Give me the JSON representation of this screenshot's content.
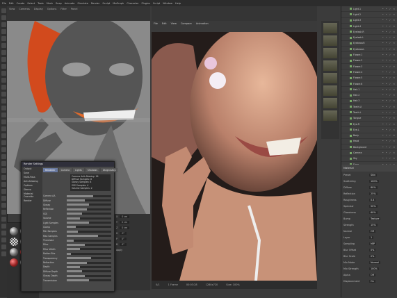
{
  "menu": [
    "File",
    "Edit",
    "Create",
    "Select",
    "Tools",
    "Mesh",
    "Snap",
    "Animate",
    "Simulate",
    "Render",
    "Sculpt",
    "MoGraph",
    "Character",
    "Plugins",
    "Script",
    "Window",
    "Help"
  ],
  "viewport_toolbar": [
    "View",
    "Cameras",
    "Display",
    "Options",
    "Filter",
    "Panel"
  ],
  "render_window": {
    "menu": [
      "File",
      "Edit",
      "View",
      "Compare",
      "Animation"
    ],
    "status": [
      "0/1",
      "1 Frame",
      "00:03:28",
      "1280x720",
      "Size: 100%"
    ]
  },
  "object_manager": {
    "rows": [
      {
        "label": "Light.1"
      },
      {
        "label": "Light.2"
      },
      {
        "label": "Light.3"
      },
      {
        "label": "Light.4"
      },
      {
        "label": "Eyelash.R"
      },
      {
        "label": "Eyelash.L"
      },
      {
        "label": "Eyebrow.R"
      },
      {
        "label": "Eyebrow.L"
      },
      {
        "label": "Flower.1"
      },
      {
        "label": "Flower.2"
      },
      {
        "label": "Flower.3"
      },
      {
        "label": "Flower.4"
      },
      {
        "label": "Flower.5"
      },
      {
        "label": "Flower.6"
      },
      {
        "label": "Hair.1"
      },
      {
        "label": "Hair.2"
      },
      {
        "label": "Hair.3"
      },
      {
        "label": "Teeth.U"
      },
      {
        "label": "Teeth.L"
      },
      {
        "label": "Tongue"
      },
      {
        "label": "Eye.R"
      },
      {
        "label": "Eye.L"
      },
      {
        "label": "Body"
      },
      {
        "label": "Head"
      },
      {
        "label": "Background"
      },
      {
        "label": "Camera"
      },
      {
        "label": "Sky"
      },
      {
        "label": "Floor"
      },
      {
        "label": "Null"
      }
    ]
  },
  "attributes": {
    "header": "Material",
    "tabs": [
      "Basic",
      "Shader",
      "Channels",
      "Advanced"
    ],
    "rows": [
      {
        "label": "Preset",
        "value": "Skin"
      },
      {
        "label": "Scattering",
        "value": "100%"
      },
      {
        "label": "Diffuse",
        "value": "80%"
      },
      {
        "label": "Reflection",
        "value": "25%"
      },
      {
        "label": "Roughness",
        "value": "0.4"
      },
      {
        "label": "Specular",
        "value": "50%"
      },
      {
        "label": "Glossiness",
        "value": "60%"
      },
      {
        "label": "Bump",
        "value": "Texture"
      },
      {
        "label": "Strength",
        "value": "15%"
      },
      {
        "label": "Normal",
        "value": "Off"
      },
      {
        "label": "Layer",
        "value": "1"
      },
      {
        "label": "Sampling",
        "value": "MIP"
      },
      {
        "label": "Blur Offset",
        "value": "0%"
      },
      {
        "label": "Blur Scale",
        "value": "0%"
      },
      {
        "label": "Mix Mode",
        "value": "Normal"
      },
      {
        "label": "Mix Strength",
        "value": "100%"
      },
      {
        "label": "Alpha",
        "value": "Off"
      },
      {
        "label": "Displacement",
        "value": "On"
      }
    ]
  },
  "dialog": {
    "title": "Render Settings",
    "left_items": [
      "Output",
      "Save",
      "Multi-Pass",
      "Anti-Aliasing",
      "Options",
      "Stereo",
      "Material Override",
      "Render"
    ],
    "tabs": [
      "Renderer",
      "Camera",
      "Lights",
      "Shadows",
      "Diagnostics"
    ],
    "info": [
      "Camera Anti-Aliasing: 16",
      "Diffuse Samples: 8",
      "Glossy Samples: 8",
      "SSS Samples: 4",
      "Volume Samples: 2"
    ],
    "rows": [
      {
        "label": "Camera AA",
        "fill": 0.6
      },
      {
        "label": "Diffuse",
        "fill": 0.4
      },
      {
        "label": "Glossy",
        "fill": 0.5
      },
      {
        "label": "Reflection",
        "fill": 0.45
      },
      {
        "label": "SSS",
        "fill": 0.35
      },
      {
        "label": "Volume",
        "fill": 0.3
      },
      {
        "label": "Light Samples",
        "fill": 0.5
      },
      {
        "label": "Clamp",
        "fill": 0.2
      },
      {
        "label": "Min Samples",
        "fill": 0.25
      },
      {
        "label": "Max Samples",
        "fill": 0.7
      },
      {
        "label": "Threshold",
        "fill": 0.15
      },
      {
        "label": "Filter",
        "fill": 0.4
      },
      {
        "label": "Filter Width",
        "fill": 0.3
      },
      {
        "label": "Motion Blur",
        "fill": 0.1
      },
      {
        "label": "Transparency",
        "fill": 0.55
      },
      {
        "label": "Refraction",
        "fill": 0.45
      },
      {
        "label": "Depth",
        "fill": 0.3
      },
      {
        "label": "Diffuse Depth",
        "fill": 0.35
      },
      {
        "label": "Glossy Depth",
        "fill": 0.4
      },
      {
        "label": "Transmission",
        "fill": 0.5
      }
    ]
  },
  "coords": {
    "rows": [
      {
        "label": "X",
        "value": "0 cm"
      },
      {
        "label": "Y",
        "value": "0 cm"
      },
      {
        "label": "Z",
        "value": "0 cm"
      },
      {
        "label": "H",
        "value": "0°"
      },
      {
        "label": "P",
        "value": "0°"
      },
      {
        "label": "B",
        "value": "0°"
      },
      {
        "label": "Apply",
        "value": ""
      }
    ]
  }
}
